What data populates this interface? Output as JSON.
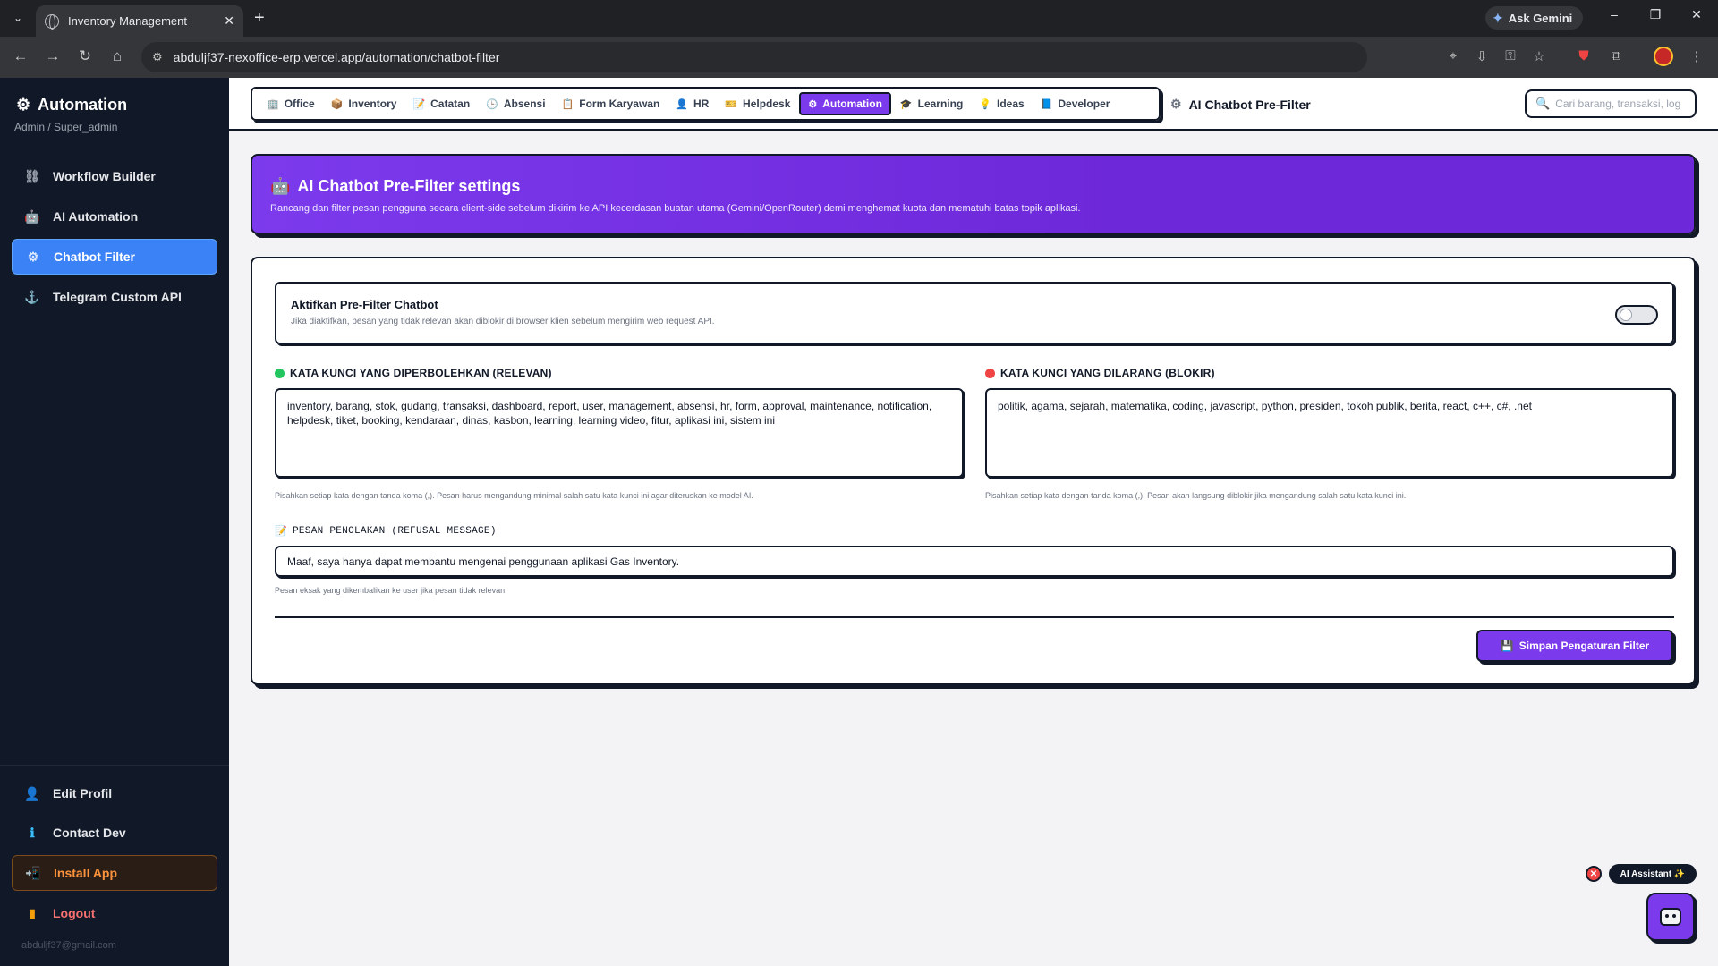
{
  "browser": {
    "tab_title": "Inventory Management",
    "new_tab": "+",
    "ask_gemini": "Ask Gemini",
    "url": "abduljf37-nexoffice-erp.vercel.app/automation/chatbot-filter"
  },
  "sidebar": {
    "title": "Automation",
    "subtitle": "Admin / Super_admin",
    "items": [
      {
        "label": "Workflow Builder",
        "icon": "workflow-icon"
      },
      {
        "label": "AI Automation",
        "icon": "robot-icon"
      },
      {
        "label": "Chatbot Filter",
        "icon": "gear-icon",
        "active": true
      },
      {
        "label": "Telegram Custom API",
        "icon": "anchor-icon"
      }
    ],
    "bottom_items": [
      {
        "label": "Edit Profil",
        "icon": "user-icon"
      },
      {
        "label": "Contact Dev",
        "icon": "info-icon"
      },
      {
        "label": "Install App",
        "icon": "install-icon"
      },
      {
        "label": "Logout",
        "icon": "door-icon"
      }
    ],
    "email": "abduljf37@gmail.com"
  },
  "topnav": {
    "menu": [
      {
        "label": "Office",
        "icon": "🏢"
      },
      {
        "label": "Inventory",
        "icon": "📦"
      },
      {
        "label": "Catatan",
        "icon": "📝"
      },
      {
        "label": "Absensi",
        "icon": "🕒"
      },
      {
        "label": "Form Karyawan",
        "icon": "📋"
      },
      {
        "label": "HR",
        "icon": "👤"
      },
      {
        "label": "Helpdesk",
        "icon": "🎫"
      },
      {
        "label": "Automation",
        "icon": "⚙",
        "active": true
      },
      {
        "label": "Learning",
        "icon": "🎓"
      },
      {
        "label": "Ideas",
        "icon": "💡"
      },
      {
        "label": "Developer",
        "icon": "📘"
      }
    ],
    "breadcrumb": "AI Chatbot Pre-Filter",
    "search_placeholder": "Cari barang, transaksi, log..."
  },
  "hero": {
    "title": "AI Chatbot Pre-Filter settings",
    "description": "Rancang dan filter pesan pengguna secara client-side sebelum dikirim ke API kecerdasan buatan utama (Gemini/OpenRouter) demi menghemat kuota dan mematuhi batas topik aplikasi."
  },
  "settings": {
    "toggle_title": "Aktifkan Pre-Filter Chatbot",
    "toggle_desc": "Jika diaktifkan, pesan yang tidak relevan akan diblokir di browser klien sebelum mengirim web request API.",
    "toggle_on": false,
    "allowed_label": "KATA KUNCI YANG DIPERBOLEHKAN (RELEVAN)",
    "allowed_value": "inventory, barang, stok, gudang, transaksi, dashboard, report, user, management, absensi, hr, form, approval, maintenance, notification, helpdesk, tiket, booking, kendaraan, dinas, kasbon, learning, learning video, fitur, aplikasi ini, sistem ini",
    "allowed_help": "Pisahkan setiap kata dengan tanda koma (,). Pesan harus mengandung minimal salah satu kata kunci ini agar diteruskan ke model AI.",
    "blocked_label": "KATA KUNCI YANG DILARANG (BLOKIR)",
    "blocked_value": "politik, agama, sejarah, matematika, coding, javascript, python, presiden, tokoh publik, berita, react, c++, c#, .net",
    "blocked_help": "Pisahkan setiap kata dengan tanda koma (,). Pesan akan langsung diblokir jika mengandung salah satu kata kunci ini.",
    "refusal_label": "PESAN PENOLAKAN (REFUSAL MESSAGE)",
    "refusal_value": "Maaf, saya hanya dapat membantu mengenai penggunaan aplikasi Gas Inventory.",
    "refusal_help": "Pesan eksak yang dikembalikan ke user jika pesan tidak relevan.",
    "save_label": "Simpan Pengaturan Filter"
  },
  "assistant": {
    "label": "AI Assistant ✨",
    "close": "✕"
  },
  "colors": {
    "accent": "#7c3aed",
    "sidebar_bg": "#111827",
    "active_blue": "#3b82f6",
    "allowed_dot": "#22c55e",
    "blocked_dot": "#ef4444"
  }
}
